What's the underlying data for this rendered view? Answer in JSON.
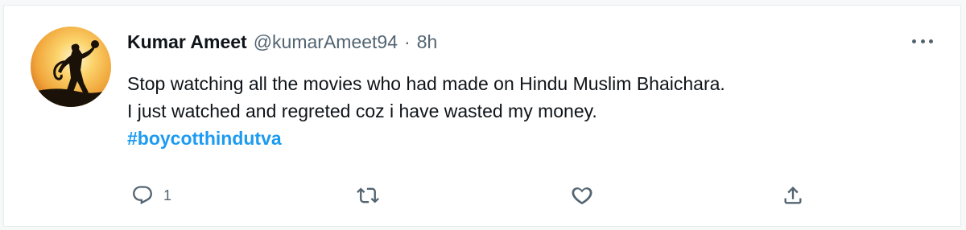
{
  "tweet": {
    "author": {
      "name": "Kumar Ameet",
      "handle": "@kumarAmeet94",
      "separator": "·",
      "time": "8h"
    },
    "text_lines": [
      "Stop watching all the movies who had made on Hindu Muslim Bhaichara.",
      "I just watched and regreted coz i have wasted my money."
    ],
    "hashtag": "#boycotthindutva",
    "actions": {
      "reply_count": "1"
    }
  },
  "colors": {
    "accent": "#1d9bf0",
    "text": "#0f1419",
    "muted": "#536471",
    "avatar_background": "#f0a53a"
  },
  "icons": {
    "reply": "reply-icon",
    "retweet": "retweet-icon",
    "like": "heart-icon",
    "share": "share-icon",
    "more": "more-dots-icon"
  }
}
